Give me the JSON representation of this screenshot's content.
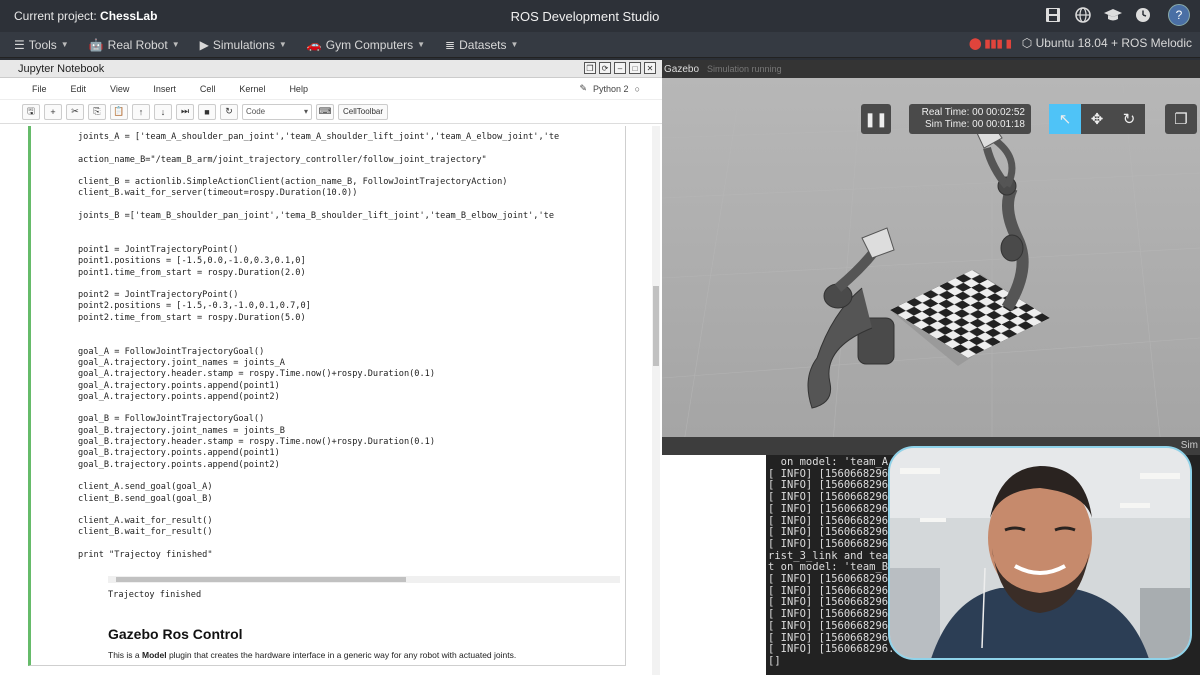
{
  "topbar": {
    "project_prefix": "Current project:",
    "project_name": "ChessLab",
    "title": "ROS Development Studio",
    "avatar_letter": "?"
  },
  "menubar": {
    "items": [
      {
        "label": "Tools",
        "icon": "hamburger-icon"
      },
      {
        "label": "Real Robot",
        "icon": "robot-icon"
      },
      {
        "label": "Simulations",
        "icon": "play-icon"
      },
      {
        "label": "Gym Computers",
        "icon": "car-icon"
      },
      {
        "label": "Datasets",
        "icon": "database-icon"
      }
    ],
    "ubuntu_label": "Ubuntu 18.04 + ROS Melodic",
    "accent_red": "#e0443c"
  },
  "jupyter": {
    "panel_title": "Jupyter Notebook",
    "menu": [
      "File",
      "Edit",
      "View",
      "Insert",
      "Cell",
      "Kernel",
      "Help"
    ],
    "kernel": "Python 2",
    "cell_type": "Code",
    "celltoolbar": "CellToolbar",
    "code_lines": [
      {
        "t": "joints_A = ['team_A_shoulder_pan_joint','team_A_shoulder_lift_joint','team_A_elbow_joint','te"
      },
      {
        "t": ""
      },
      {
        "t": "action_name_B=\"/team_B_arm/joint_trajectory_controller/follow_joint_trajectory\""
      },
      {
        "t": ""
      },
      {
        "t": "client_B = actionlib.SimpleActionClient(action_name_B, FollowJointTrajectoryAction)"
      },
      {
        "t": "client_B.wait_for_server(timeout=rospy.Duration(10.0))"
      },
      {
        "t": ""
      },
      {
        "t": "joints_B =['team_B_shoulder_pan_joint','tema_B_shoulder_lift_joint','team_B_elbow_joint','te"
      },
      {
        "t": ""
      },
      {
        "t": ""
      },
      {
        "t": "point1 = JointTrajectoryPoint()"
      },
      {
        "t": "point1.positions = [-1.5,0.0,-1.0,0.3,0.1,0]"
      },
      {
        "t": "point1.time_from_start = rospy.Duration(2.0)"
      },
      {
        "t": ""
      },
      {
        "t": "point2 = JointTrajectoryPoint()"
      },
      {
        "t": "point2.positions = [-1.5,-0.3,-1.0,0.1,0.7,0]"
      },
      {
        "t": "point2.time_from_start = rospy.Duration(5.0)"
      },
      {
        "t": ""
      },
      {
        "t": ""
      },
      {
        "t": "goal_A = FollowJointTrajectoryGoal()"
      },
      {
        "t": "goal_A.trajectory.joint_names = joints_A"
      },
      {
        "t": "goal_A.trajectory.header.stamp = rospy.Time.now()+rospy.Duration(0.1)"
      },
      {
        "t": "goal_A.trajectory.points.append(point1)"
      },
      {
        "t": "goal_A.trajectory.points.append(point2)"
      },
      {
        "t": ""
      },
      {
        "t": "goal_B = FollowJointTrajectoryGoal()"
      },
      {
        "t": "goal_B.trajectory.joint_names = joints_B"
      },
      {
        "t": "goal_B.trajectory.header.stamp = rospy.Time.now()+rospy.Duration(0.1)"
      },
      {
        "t": "goal_B.trajectory.points.append(point1)"
      },
      {
        "t": "goal_B.trajectory.points.append(point2)"
      },
      {
        "t": ""
      },
      {
        "t": "client_A.send_goal(goal_A)"
      },
      {
        "t": "client_B.send_goal(goal_B)"
      },
      {
        "t": ""
      },
      {
        "t": "client_A.wait_for_result()"
      },
      {
        "t": "client_B.wait_for_result()"
      },
      {
        "t": ""
      },
      {
        "t": "print \"Trajectoy finished\""
      }
    ],
    "output": "Trajectoy finished",
    "md_heading": "Gazebo Ros Control",
    "md_paragraph_pre": "This is a ",
    "md_paragraph_bold": "Model",
    "md_paragraph_post": " plugin that creates the hardware interface in a generic way for any robot with actuated joints."
  },
  "gazebo": {
    "panel_title": "Gazebo",
    "status": "Simulation running",
    "real_time_label": "Real Time: 00 00:02:52",
    "sim_time_label": "Sim Time: 00 00:01:18",
    "sim_label": "Sim"
  },
  "terminal": {
    "lines": [
      "  on model: 'team_A_s",
      "[ INFO] [1560668296.",
      "[ INFO] [1560668296.",
      "[ INFO] [1560668296.",
      "[ INFO] [1560668296.",
      "[ INFO] [1560668296.",
      "[ INFO] [1560668296.",
      "[ INFO] [1560668296.",
      "rist_3_link and tea",
      "t on model: 'team_B",
      "[ INFO] [1560668296.",
      "[ INFO] [1560668296.",
      "[ INFO] [1560668296.",
      "[ INFO] [1560668296.",
      "[ INFO] [1560668296.",
      "[ INFO] [1560668296.",
      "[ INFO] [1560668296.21",
      "[]"
    ]
  }
}
